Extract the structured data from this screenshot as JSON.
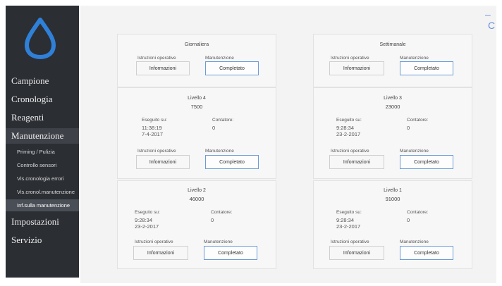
{
  "colors": {
    "sidebar": "#2b2e33",
    "accent_blue": "#2f80d8",
    "content_bg": "#f3f3f3"
  },
  "logo": {
    "icon": "water-drop-icon"
  },
  "sidebar": {
    "items": [
      {
        "label": "Campione"
      },
      {
        "label": "Cronologia"
      },
      {
        "label": "Reagenti"
      },
      {
        "label": "Manutenzione"
      },
      {
        "label": "Impostazioni"
      },
      {
        "label": "Servizio"
      }
    ],
    "subitems": [
      {
        "label": "Priming / Pulizia"
      },
      {
        "label": "Controllo sensori"
      },
      {
        "label": "Vis.cronologia errori"
      },
      {
        "label": "Vis.cronol.manutenzione"
      },
      {
        "label": "Inf.sulla manutenzione"
      }
    ]
  },
  "window": {
    "minimize": "–",
    "other": "C"
  },
  "panels": {
    "giornaliera": {
      "title": "Giornaliera",
      "instr_label": "Istruzioni operative",
      "maint_label": "Manutenzione",
      "info_button": "Informazioni",
      "status_button": "Completato"
    },
    "settimanale": {
      "title": "Settimanale",
      "instr_label": "Istruzioni operative",
      "maint_label": "Manutenzione",
      "info_button": "Informazioni",
      "status_button": "Completato"
    },
    "livello4": {
      "title": "Livello 4",
      "value": "7500",
      "exec_label": "Eseguito su:",
      "count_label": "Contatore:",
      "exec_time": "11:38:19",
      "exec_date": "7-4-2017",
      "count_value": "0",
      "instr_label": "Istruzioni operative",
      "maint_label": "Manutenzione",
      "info_button": "Informazioni",
      "status_button": "Completato"
    },
    "livello3": {
      "title": "Livello 3",
      "value": "23000",
      "exec_label": "Eseguito su:",
      "count_label": "Contatore:",
      "exec_time": "9:28:34",
      "exec_date": "23-2-2017",
      "count_value": "0",
      "instr_label": "Istruzioni operative",
      "maint_label": "Manutenzione",
      "info_button": "Informazioni",
      "status_button": "Completato"
    },
    "livello2": {
      "title": "Livello 2",
      "value": "46000",
      "exec_label": "Eseguito su:",
      "count_label": "Contatore:",
      "exec_time": "9:28:34",
      "exec_date": "23-2-2017",
      "count_value": "0",
      "instr_label": "Istruzioni operative",
      "maint_label": "Manutenzione",
      "info_button": "Informazioni",
      "status_button": "Completato"
    },
    "livello1": {
      "title": "Livello 1",
      "value": "91000",
      "exec_label": "Eseguito su:",
      "count_label": "Contatore:",
      "exec_time": "9:28:34",
      "exec_date": "23-2-2017",
      "count_value": "0",
      "instr_label": "Istruzioni operative",
      "maint_label": "Manutenzione",
      "info_button": "Informazioni",
      "status_button": "Completato"
    }
  }
}
